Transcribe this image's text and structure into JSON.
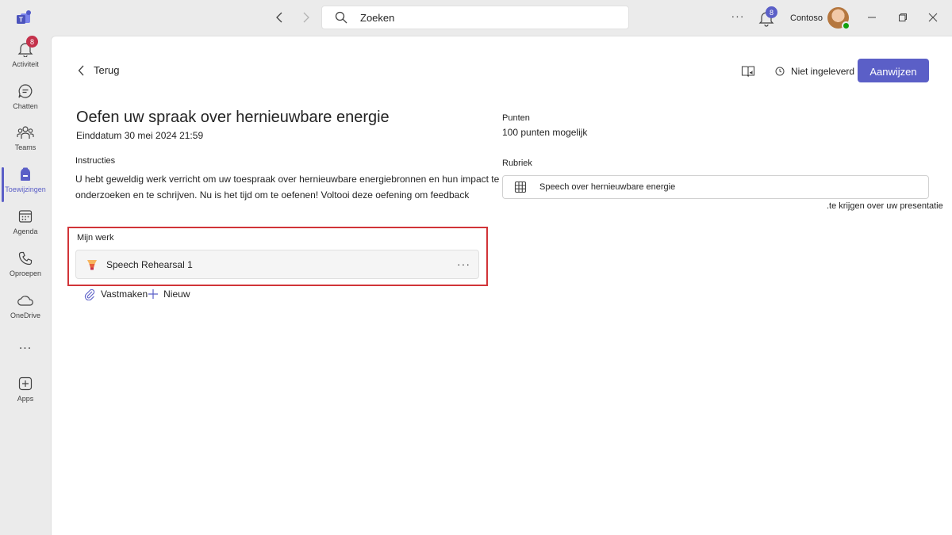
{
  "titlebar": {
    "search_placeholder": "Zoeken",
    "notifications_count": "8",
    "org_name": "Contoso"
  },
  "rail": {
    "items": [
      {
        "label": "Activiteit",
        "icon": "bell-icon",
        "badge": "8"
      },
      {
        "label": "Chatten",
        "icon": "chat-icon"
      },
      {
        "label": "Teams",
        "icon": "teams-icon"
      },
      {
        "label": "Toewijzingen",
        "icon": "assignments-icon",
        "active": true
      },
      {
        "label": "Agenda",
        "icon": "calendar-icon"
      },
      {
        "label": "Oproepen",
        "icon": "phone-icon"
      },
      {
        "label": "OneDrive",
        "icon": "cloud-icon"
      },
      {
        "label": "Apps",
        "icon": "add-apps-icon"
      }
    ],
    "more": "..."
  },
  "header": {
    "back_label": "Terug",
    "status_label": "Niet ingeleverd",
    "assign_label": "Aanwijzen"
  },
  "assignment": {
    "title": "Oefen uw spraak over hernieuwbare energie",
    "due": "Einddatum 30 mei 2024 21:59",
    "instructions_label": "Instructies",
    "instructions": "U hebt geweldig werk verricht om uw toespraak over hernieuwbare energiebronnen en hun impact te onderzoeken en te schrijven. Nu is het tijd om te oefenen! Voltooi deze oefening om feedback",
    "instructions_overflow": ".te krijgen over uw presentatie",
    "my_work_label": "Mijn werk",
    "work_item": "Speech Rehearsal 1",
    "attach_label": "Vastmaken",
    "new_label": "Nieuw"
  },
  "sidebar_info": {
    "points_label": "Punten",
    "points_value": "100 punten mogelijk",
    "rubric_label": "Rubriek",
    "rubric_name": "Speech over hernieuwbare energie"
  },
  "colors": {
    "accent": "#5b5fc7",
    "highlight_border": "#d13438",
    "badge_red": "#c4314b"
  }
}
